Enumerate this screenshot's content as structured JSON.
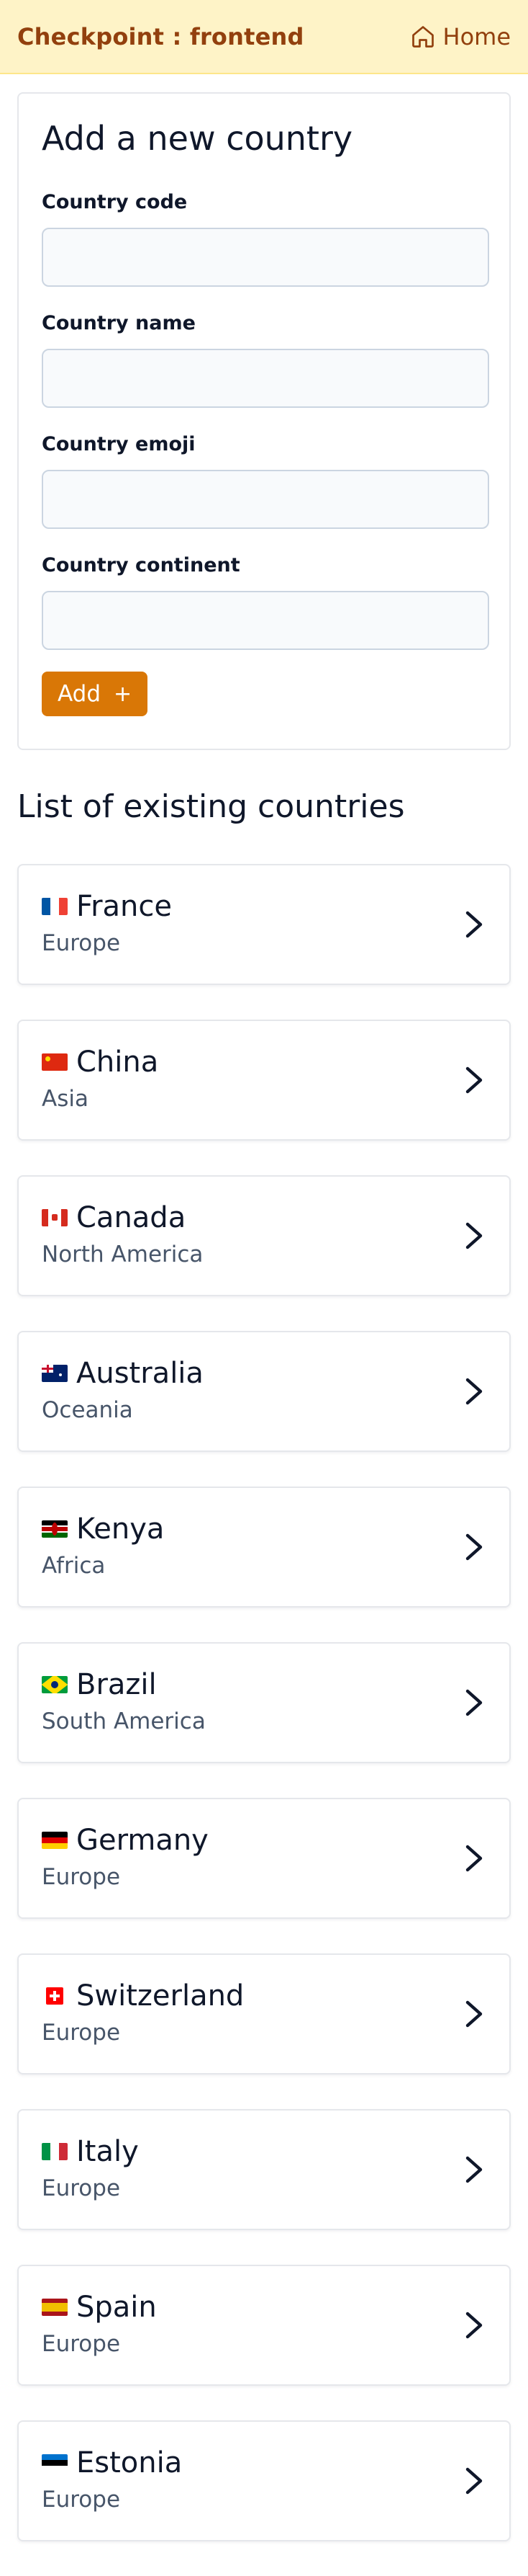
{
  "header": {
    "brand": "Checkpoint : frontend",
    "home_label": "Home"
  },
  "form": {
    "title": "Add a new country",
    "fields": [
      {
        "label": "Country code",
        "value": ""
      },
      {
        "label": "Country name",
        "value": ""
      },
      {
        "label": "Country emoji",
        "value": ""
      },
      {
        "label": "Country continent",
        "value": ""
      }
    ],
    "add_label": "Add",
    "add_icon": "+"
  },
  "list": {
    "title": "List of existing countries",
    "countries": [
      {
        "name": "France",
        "continent": "Europe",
        "flag": "flag-fr"
      },
      {
        "name": "China",
        "continent": "Asia",
        "flag": "flag-cn"
      },
      {
        "name": "Canada",
        "continent": "North America",
        "flag": "flag-ca"
      },
      {
        "name": "Australia",
        "continent": "Oceania",
        "flag": "flag-au"
      },
      {
        "name": "Kenya",
        "continent": "Africa",
        "flag": "flag-ke"
      },
      {
        "name": "Brazil",
        "continent": "South America",
        "flag": "flag-br"
      },
      {
        "name": "Germany",
        "continent": "Europe",
        "flag": "flag-de"
      },
      {
        "name": "Switzerland",
        "continent": "Europe",
        "flag": "flag-ch"
      },
      {
        "name": "Italy",
        "continent": "Europe",
        "flag": "flag-it"
      },
      {
        "name": "Spain",
        "continent": "Europe",
        "flag": "flag-es"
      },
      {
        "name": "Estonia",
        "continent": "Europe",
        "flag": "flag-ee"
      }
    ]
  },
  "colors": {
    "header_bg": "#fef3c7",
    "brand": "#92400e",
    "accent": "#d97706"
  }
}
